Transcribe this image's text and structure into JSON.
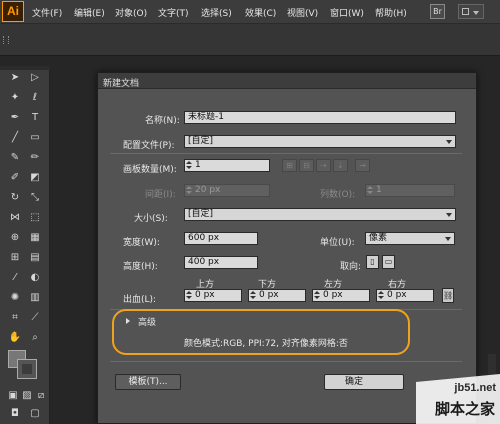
{
  "app": {
    "logo": "Ai"
  },
  "menubar": {
    "items": [
      "文件(F)",
      "编辑(E)",
      "对象(O)",
      "文字(T)",
      "选择(S)",
      "效果(C)",
      "视图(V)",
      "窗口(W)",
      "帮助(H)"
    ],
    "bridge": "Br"
  },
  "dialog": {
    "title": "新建文档",
    "name": {
      "label": "名称(N):",
      "value": "未标题-1"
    },
    "profile": {
      "label": "配置文件(P):",
      "value": "[自定]"
    },
    "artboards": {
      "label": "画板数量(M):",
      "value": "1"
    },
    "spacing": {
      "label": "间距(I):",
      "value": "20 px"
    },
    "columns": {
      "label": "列数(O):",
      "value": "1"
    },
    "size": {
      "label": "大小(S):",
      "value": "[自定]"
    },
    "width": {
      "label": "宽度(W):",
      "value": "600 px"
    },
    "units": {
      "label": "单位(U):",
      "value": "像素"
    },
    "height": {
      "label": "高度(H):",
      "value": "400 px"
    },
    "orientation": {
      "label": "取向:"
    },
    "bleed": {
      "label": "出血(L):",
      "top": {
        "label": "上方",
        "value": "0 px"
      },
      "bottom": {
        "label": "下方",
        "value": "0 px"
      },
      "left": {
        "label": "左方",
        "value": "0 px"
      },
      "right": {
        "label": "右方",
        "value": "0 px"
      }
    },
    "advanced": {
      "label": "高级",
      "summary": "颜色模式:RGB, PPI:72, 对齐像素网格:否",
      "highlight_color": "#f0a21c"
    },
    "buttons": {
      "templates": "模板(T)...",
      "ok": "确定"
    }
  },
  "watermark": {
    "site": "jb51.net",
    "name": "脚本之家"
  }
}
